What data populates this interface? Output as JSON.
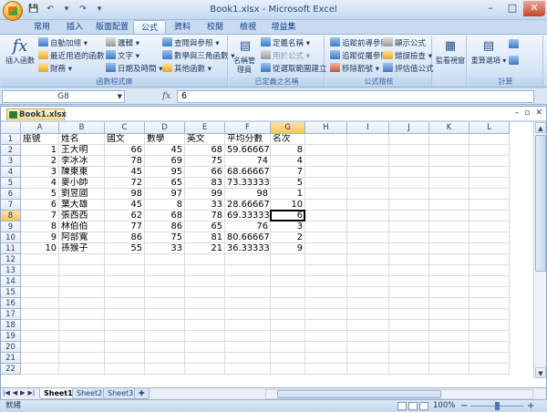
{
  "window": {
    "title": "Book1.xlsx - Microsoft Excel",
    "minimize": "–",
    "maximize": "□",
    "close": "✕"
  },
  "qat": {
    "save": "💾",
    "undo": "↶",
    "undo_dd": "▾",
    "redo": "↷",
    "more": "▾"
  },
  "tabs": [
    "常用",
    "插入",
    "版面配置",
    "公式",
    "資料",
    "校閱",
    "檢視",
    "增益集"
  ],
  "active_tab": 3,
  "ribbon": {
    "function_library": {
      "label": "函數程式庫",
      "insert_function": "插入函數",
      "fx": "fx",
      "autosum": "自動加總 ▾",
      "recent": "最近用過的函數 ▾",
      "financial": "財務 ▾",
      "logical": "邏輯 ▾",
      "text": "文字 ▾",
      "datetime": "日期及時間 ▾",
      "lookup": "查閱與參照 ▾",
      "math": "數學與三角函數 ▾",
      "more": "其他函數 ▾"
    },
    "defined_names": {
      "label": "已定義之名稱",
      "name_manager": "名稱管理員",
      "define_name": "定義名稱 ▾",
      "use_in_formula": "用於公式 ▾",
      "create_from_selection": "從選取範圍建立"
    },
    "formula_auditing": {
      "label": "公式稽核",
      "trace_precedents": "追蹤前導參照",
      "trace_dependents": "追蹤從屬參照",
      "remove_arrows": "移除箭號 ▾",
      "show_formulas": "顯示公式",
      "error_checking": "錯誤檢查 ▾",
      "evaluate": "評估值公式"
    },
    "watch_window": "監看視窗",
    "calculation": {
      "label": "計算",
      "options": "重算選項 ▾"
    }
  },
  "formula_bar": {
    "name_box": "G8",
    "fx": "fx",
    "value": "6"
  },
  "workbook_tab": "Book1.xlsx",
  "columns": [
    "A",
    "B",
    "C",
    "D",
    "E",
    "F",
    "G",
    "H",
    "I",
    "J",
    "K",
    "L"
  ],
  "rows": [
    "1",
    "2",
    "3",
    "4",
    "5",
    "6",
    "7",
    "8",
    "9",
    "10",
    "11",
    "12",
    "13",
    "14",
    "15",
    "16",
    "17",
    "18",
    "19",
    "20",
    "21",
    "22"
  ],
  "sheet": [
    [
      "座號",
      "姓名",
      "國文",
      "數學",
      "英文",
      "平均分數",
      "名次"
    ],
    [
      "1",
      "王大明",
      "66",
      "45",
      "68",
      "59.66667",
      "8"
    ],
    [
      "2",
      "李冰冰",
      "78",
      "69",
      "75",
      "74",
      "4"
    ],
    [
      "3",
      "陳東東",
      "45",
      "95",
      "66",
      "68.66667",
      "7"
    ],
    [
      "4",
      "麥小帥",
      "72",
      "65",
      "83",
      "73.33333",
      "5"
    ],
    [
      "5",
      "劉昱國",
      "98",
      "97",
      "99",
      "98",
      "1"
    ],
    [
      "6",
      "葉大雄",
      "45",
      "8",
      "33",
      "28.66667",
      "10"
    ],
    [
      "7",
      "張西西",
      "62",
      "68",
      "78",
      "69.33333",
      "6"
    ],
    [
      "8",
      "林伯伯",
      "77",
      "86",
      "65",
      "76",
      "3"
    ],
    [
      "9",
      "阿部寬",
      "86",
      "75",
      "81",
      "80.66667",
      "2"
    ],
    [
      "10",
      "孫猴子",
      "55",
      "33",
      "21",
      "36.33333",
      "9"
    ]
  ],
  "selected": {
    "col": "G",
    "row": "8"
  },
  "sheet_tabs": [
    "Sheet1",
    "Sheet2",
    "Sheet3"
  ],
  "active_sheet": 0,
  "status": {
    "ready": "就緒",
    "zoom": "100%",
    "minus": "−",
    "plus": "+"
  }
}
